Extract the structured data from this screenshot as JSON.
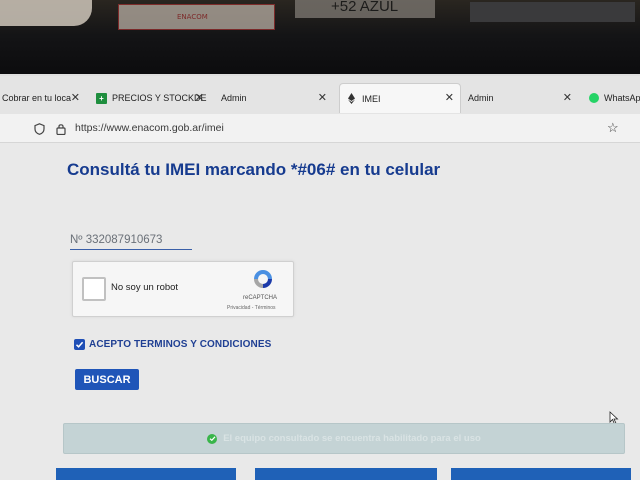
{
  "tabs": [
    {
      "label": "Cobrar en tu loca",
      "icon": "none",
      "active": false
    },
    {
      "label": "PRECIOS Y STOCKDE",
      "icon": "google-sheets-icon",
      "active": false
    },
    {
      "label": "Admin",
      "icon": "none",
      "active": false
    },
    {
      "label": "IMEI",
      "icon": "enacom-icon",
      "active": true
    },
    {
      "label": "Admin",
      "icon": "none",
      "active": false
    },
    {
      "label": "WhatsAp",
      "icon": "whatsapp-icon",
      "active": false
    }
  ],
  "urlbar": {
    "url": "https://www.enacom.gob.ar/imei"
  },
  "page": {
    "title": "Consultá tu IMEI marcando *#06# en tu celular",
    "imei_value": "Nº 332087910673",
    "captcha": {
      "label": "No soy un robot",
      "brand": "reCAPTCHA",
      "links": "Privacidad - Términos"
    },
    "terms": {
      "label": "ACEPTO TERMINOS Y CONDICIONES",
      "checked": true
    },
    "search_button": "BUSCAR",
    "result_message": "El equipo consultado se encuentra habilitado para el uso"
  },
  "background": {
    "sign_text": "+52 AZUL",
    "paper_text": "ENACOM"
  },
  "colors": {
    "title": "#163b8f",
    "button": "#1f55b8",
    "result_bg": "#c4d3d5",
    "ok": "#39b54a"
  }
}
